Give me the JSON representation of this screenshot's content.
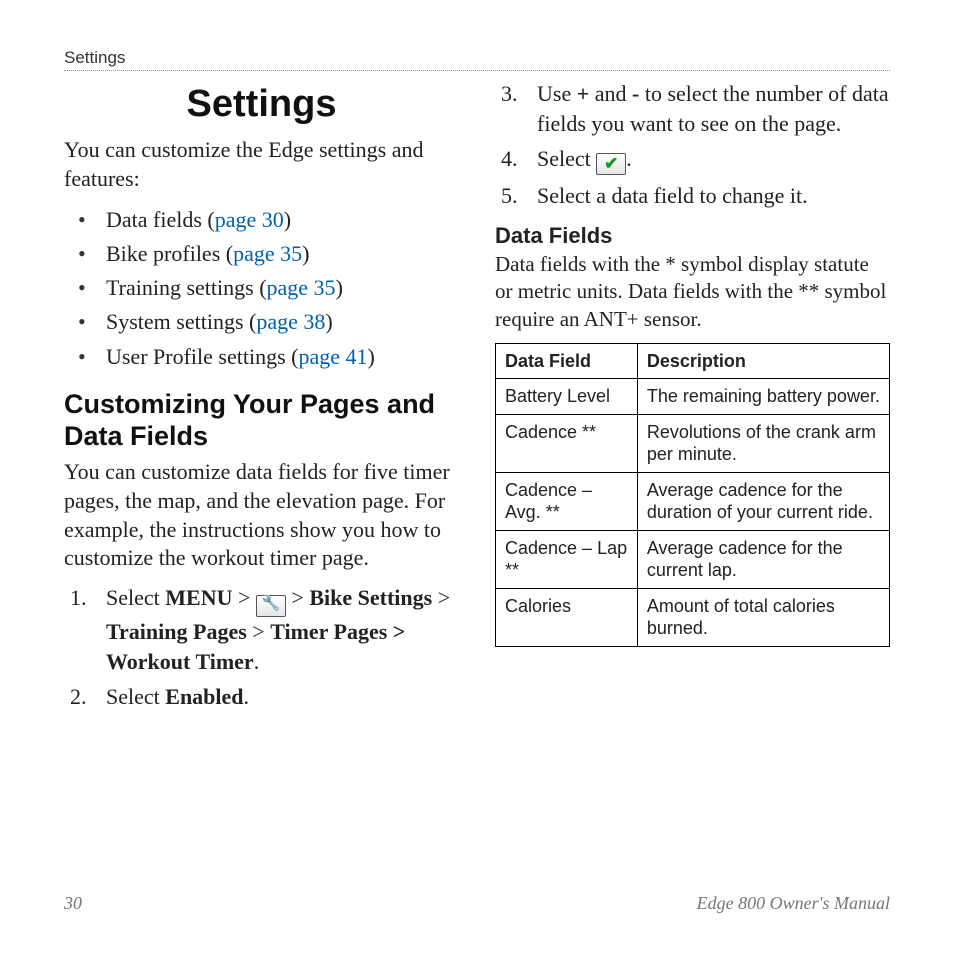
{
  "running_head": "Settings",
  "title": "Settings",
  "intro": "You can customize the Edge settings and features:",
  "bullets": [
    {
      "text": "Data fields (",
      "link": "page 30",
      "after": ")"
    },
    {
      "text": "Bike profiles (",
      "link": "page 35",
      "after": ")"
    },
    {
      "text": "Training settings (",
      "link": "page 35",
      "after": ")"
    },
    {
      "text": "System settings (",
      "link": "page 38",
      "after": ")"
    },
    {
      "text": "User Profile settings (",
      "link": "page 41",
      "after": ")"
    }
  ],
  "heading_customize": "Customizing Your Pages and Data Fields",
  "customize_para": "You can customize data fields for five timer pages, the map, and the elevation page. For example, the instructions show you how to customize the workout timer page.",
  "steps_a": {
    "s1_pre": "Select ",
    "s1_menu": "MENU",
    "s1_gt1": " > ",
    "s1_gt2": " > ",
    "s1_bike": "Bike Settings",
    "s1_gt3": " > ",
    "s1_training": "Training Pages",
    "s1_gt4": " > ",
    "s1_timer": "Timer Pages > Workout Timer",
    "s1_period": ".",
    "s2_pre": "Select ",
    "s2_bold": "Enabled",
    "s2_period": "."
  },
  "steps_b": {
    "s3_pre": "Use ",
    "s3_plus": "+",
    "s3_and": " and ",
    "s3_minus": "-",
    "s3_rest": " to select the number of data fields you want to see on the page.",
    "s4_pre": "Select ",
    "s4_period": ".",
    "s5": "Select a data field to change it."
  },
  "df_heading": "Data Fields",
  "df_para": "Data fields with the * symbol display statute or metric units. Data fields with the ** symbol require an ANT+ sensor.",
  "table": {
    "h1": "Data Field",
    "h2": "Description",
    "rows": [
      {
        "f": "Battery Level",
        "d": "The remaining battery power."
      },
      {
        "f": "Cadence **",
        "d": "Revolutions of the crank arm per minute."
      },
      {
        "f": "Cadence – Avg. **",
        "d": "Average cadence for the duration of your current ride."
      },
      {
        "f": "Cadence – Lap **",
        "d": "Average cadence for the current lap."
      },
      {
        "f": "Calories",
        "d": "Amount of total calories burned."
      }
    ]
  },
  "footer": {
    "page": "30",
    "doc": "Edge 800 Owner's Manual"
  }
}
